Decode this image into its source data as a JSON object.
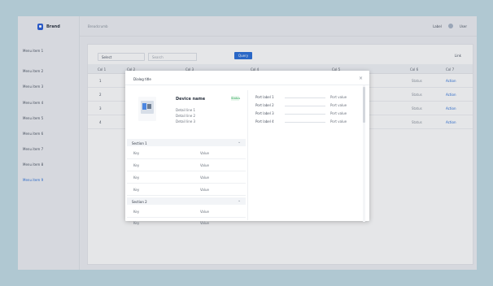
{
  "brand": {
    "logo_text": "Brand",
    "accent": "#2b6fd9"
  },
  "sidebar": {
    "items": [
      {
        "label": "Menu item 1"
      },
      {
        "label": "Menu item 2"
      },
      {
        "label": "Menu item 3"
      },
      {
        "label": "Menu item 4"
      },
      {
        "label": "Menu item 5"
      },
      {
        "label": "Menu item 6"
      },
      {
        "label": "Menu item 7"
      },
      {
        "label": "Menu item 8"
      },
      {
        "label": "Menu item 9",
        "active": true
      }
    ]
  },
  "header": {
    "breadcrumb": "Breadcrumb",
    "right_label": "Label",
    "user_label": "User"
  },
  "toolbar": {
    "filter_value": "Select",
    "search_placeholder": "Search",
    "query_label": "Query",
    "right_link": "Link"
  },
  "table": {
    "headers": [
      "Col 1",
      "Col 2",
      "Col 3",
      "Col 4",
      "Col 5",
      "Col 6",
      "Col 7"
    ],
    "rows": [
      {
        "no": "1",
        "status": "Status",
        "action": "Action"
      },
      {
        "no": "2",
        "status": "Status",
        "action": "Action"
      },
      {
        "no": "3",
        "status": "Status",
        "action": "Action"
      },
      {
        "no": "4",
        "status": "Status",
        "action": "Action"
      }
    ]
  },
  "modal": {
    "title": "Dialog title",
    "device_name": "Device name",
    "status": "Status",
    "status_color": "#2aa556",
    "meta": [
      "Detail line 1",
      "Detail line 2",
      "Detail line 3"
    ],
    "ports": [
      {
        "label": "Port label 1",
        "value": "Port value"
      },
      {
        "label": "Port label 2",
        "value": "Port value"
      },
      {
        "label": "Port label 3",
        "value": "Port value"
      },
      {
        "label": "Port label 4",
        "value": "Port value"
      }
    ],
    "section1": "Section 1",
    "section1_rows": [
      {
        "k": "Key",
        "v": "Value"
      },
      {
        "k": "Key",
        "v": "Value"
      },
      {
        "k": "Key",
        "v": "Value"
      },
      {
        "k": "Key",
        "v": "Value"
      }
    ],
    "section2": "Section 2",
    "section2_rows": [
      {
        "k": "Key",
        "v": "Value"
      },
      {
        "k": "Key",
        "v": "Value"
      }
    ]
  }
}
